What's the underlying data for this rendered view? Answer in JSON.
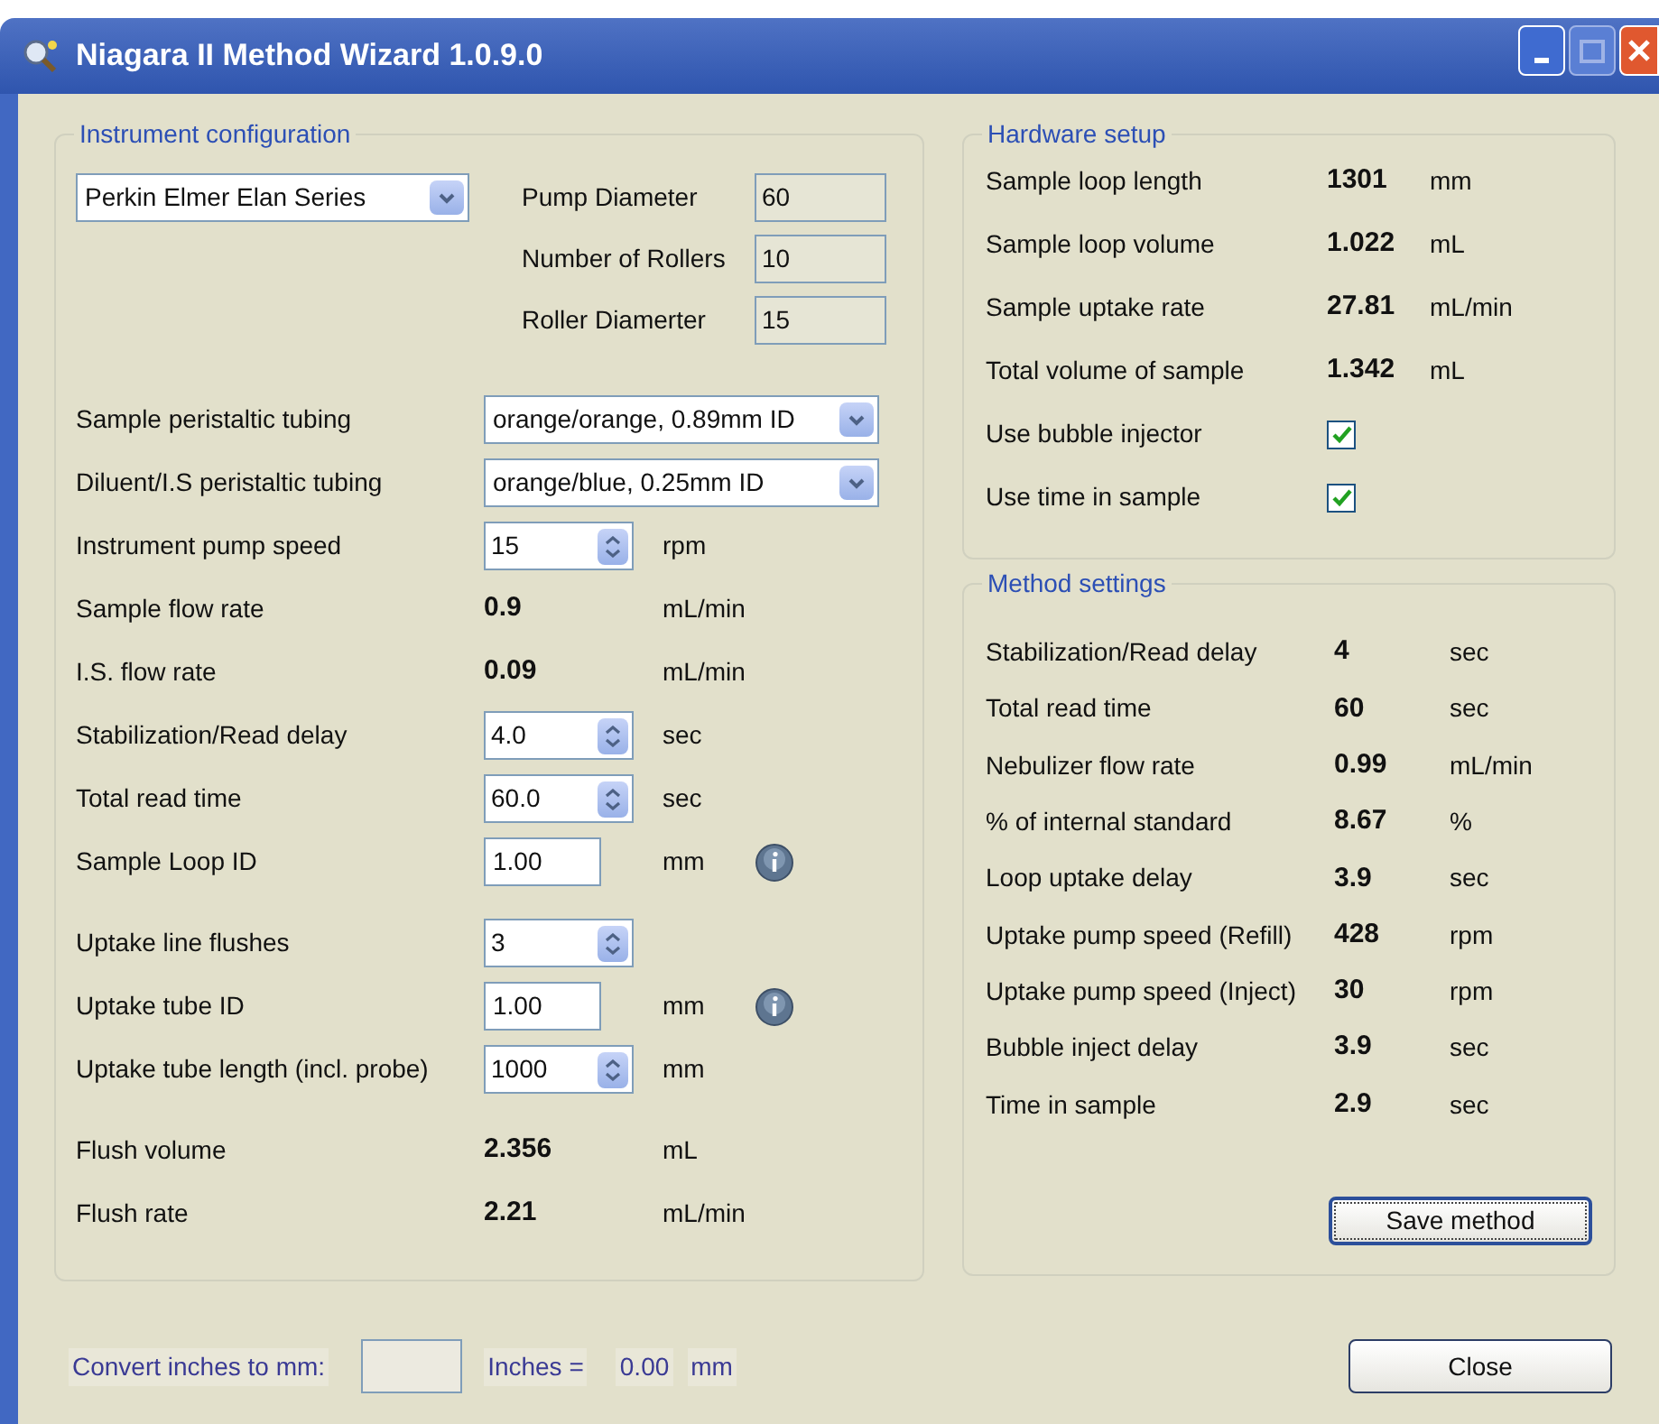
{
  "window": {
    "title": "Niagara II Method Wizard 1.0.9.0"
  },
  "instrument_configuration": {
    "title": "Instrument configuration",
    "instrument": "Perkin Elmer Elan Series",
    "pump_fields": [
      {
        "label": "Pump Diameter",
        "value": "60"
      },
      {
        "label": "Number of Rollers",
        "value": "10"
      },
      {
        "label": "Roller Diamerter",
        "value": "15"
      }
    ],
    "sections": [
      [
        {
          "kind": "select",
          "label": "Sample peristaltic tubing",
          "value": "orange/orange, 0.89mm ID"
        },
        {
          "kind": "select",
          "label": "Diluent/I.S peristaltic tubing",
          "value": "orange/blue, 0.25mm ID"
        },
        {
          "kind": "spinner",
          "label": "Instrument pump speed",
          "value": "15",
          "unit": "rpm"
        },
        {
          "kind": "readout",
          "label": "Sample flow rate",
          "value": "0.9",
          "unit": "mL/min"
        },
        {
          "kind": "readout",
          "label": "I.S. flow rate",
          "value": "0.09",
          "unit": "mL/min"
        },
        {
          "kind": "spinner",
          "label": "Stabilization/Read delay",
          "value": "4.0",
          "unit": "sec"
        },
        {
          "kind": "spinner",
          "label": "Total read time",
          "value": "60.0",
          "unit": "sec"
        },
        {
          "kind": "input",
          "label": "Sample Loop ID",
          "value": "1.00",
          "unit": "mm",
          "info": true
        }
      ],
      [
        {
          "kind": "spinner",
          "label": "Uptake line flushes",
          "value": "3"
        },
        {
          "kind": "input",
          "label": "Uptake tube ID",
          "value": "1.00",
          "unit": "mm",
          "info": true
        },
        {
          "kind": "spinner",
          "label": "Uptake tube length (incl. probe)",
          "value": "1000",
          "unit": "mm"
        }
      ],
      [
        {
          "kind": "readout",
          "label": "Flush volume",
          "value": "2.356",
          "unit": "mL"
        },
        {
          "kind": "readout",
          "label": "Flush rate",
          "value": "2.21",
          "unit": "mL/min"
        }
      ]
    ]
  },
  "hardware_setup": {
    "title": "Hardware setup",
    "rows": [
      {
        "kind": "readout",
        "label": "Sample loop length",
        "value": "1301",
        "unit": "mm"
      },
      {
        "kind": "readout",
        "label": "Sample loop volume",
        "value": "1.022",
        "unit": "mL"
      },
      {
        "kind": "readout",
        "label": "Sample uptake rate",
        "value": "27.81",
        "unit": "mL/min"
      },
      {
        "kind": "readout",
        "label": "Total volume of sample",
        "value": "1.342",
        "unit": "mL"
      },
      {
        "kind": "checkbox",
        "label": "Use bubble injector",
        "checked": true
      },
      {
        "kind": "checkbox",
        "label": "Use time in sample",
        "checked": true
      }
    ]
  },
  "method_settings": {
    "title": "Method settings",
    "rows": [
      {
        "label": "Stabilization/Read delay",
        "value": "4",
        "unit": "sec"
      },
      {
        "label": "Total read time",
        "value": "60",
        "unit": "sec"
      },
      {
        "label": "Nebulizer flow rate",
        "value": "0.99",
        "unit": "mL/min"
      },
      {
        "label": "% of internal standard",
        "value": "8.67",
        "unit": "%"
      },
      {
        "label": "Loop uptake delay",
        "value": "3.9",
        "unit": "sec"
      },
      {
        "label": "Uptake pump speed (Refill)",
        "value": "428",
        "unit": "rpm"
      },
      {
        "label": "Uptake pump speed (Inject)",
        "value": "30",
        "unit": "rpm"
      },
      {
        "label": "Bubble inject delay",
        "value": "3.9",
        "unit": "sec"
      },
      {
        "label": "Time in sample",
        "value": "2.9",
        "unit": "sec"
      }
    ],
    "save_button": "Save method"
  },
  "converter": {
    "label": "Convert inches to mm:",
    "unit_in": "Inches =",
    "result": "0.00",
    "unit_out": "mm"
  },
  "close_button": "Close"
}
